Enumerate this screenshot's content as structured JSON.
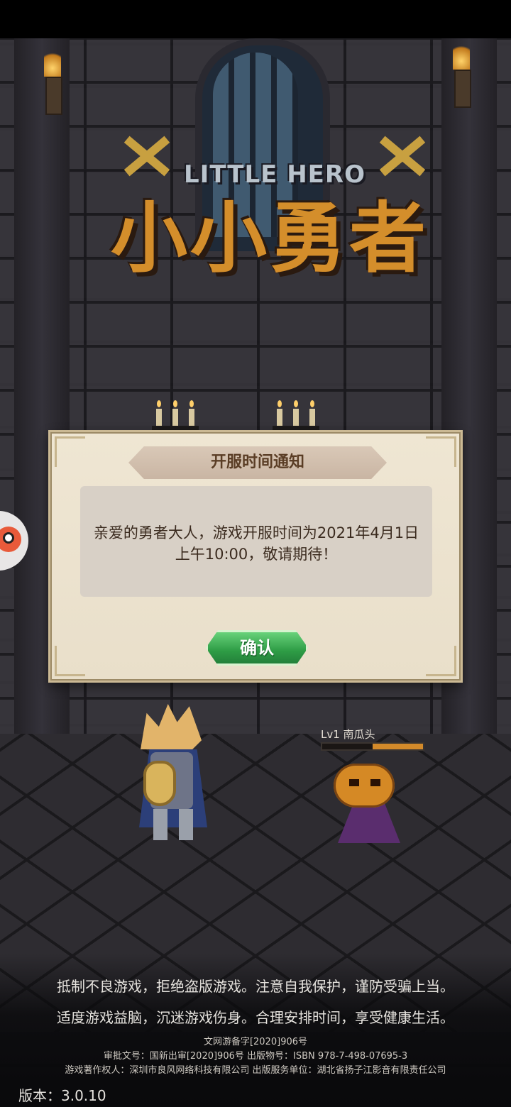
{
  "logo": {
    "subtitle": "LITTLE HERO",
    "title": "小小勇者"
  },
  "dialog": {
    "title": "开服时间通知",
    "message_line1": "亲爱的勇者大人，游戏开服时间为2021年4月1日",
    "message_line2": "上午10:00，敬请期待！",
    "confirm_label": "确认"
  },
  "enemy": {
    "label": "Lv1 南瓜头",
    "hp_fraction": 0.5
  },
  "footer": {
    "line1": "抵制不良游戏，拒绝盗版游戏。注意自我保护，谨防受骗上当。",
    "line2": "适度游戏益脑，沉迷游戏伤身。合理安排时间，享受健康生活。",
    "line3": "文网游备字[2020]906号",
    "line4": "审批文号：国新出审[2020]906号 出版物号：ISBN 978-7-498-07695-3",
    "line5": "游戏著作权人：深圳市良风网络科技有限公司 出版服务单位：湖北省扬子江影音有限责任公司",
    "version": "版本：3.0.10"
  },
  "colors": {
    "logo_gold": "#d48e2b",
    "confirm_green": "#2e9c45",
    "dialog_paper": "#efe6d3"
  },
  "icons": {
    "side_mascot": "mascot-face-icon"
  }
}
